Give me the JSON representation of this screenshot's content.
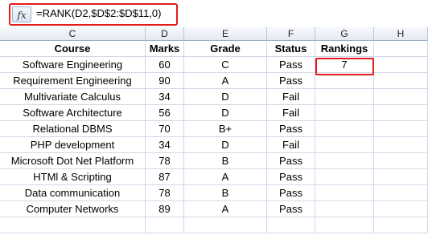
{
  "formula_bar": {
    "fx_icon": "fx-icon",
    "formula": "=RANK(D2,$D$2:$D$11,0)"
  },
  "columns": [
    "C",
    "D",
    "E",
    "F",
    "G",
    "H"
  ],
  "headers": {
    "course": "Course",
    "marks": "Marks",
    "grade": "Grade",
    "status": "Status",
    "rankings": "Rankings"
  },
  "rows": [
    {
      "course": "Software Engineering",
      "marks": "60",
      "grade": "C",
      "status": "Pass",
      "ranking": "7"
    },
    {
      "course": "Requirement Engineering",
      "marks": "90",
      "grade": "A",
      "status": "Pass",
      "ranking": ""
    },
    {
      "course": "Multivariate Calculus",
      "marks": "34",
      "grade": "D",
      "status": "Fail",
      "ranking": ""
    },
    {
      "course": "Software Architecture",
      "marks": "56",
      "grade": "D",
      "status": "Fail",
      "ranking": ""
    },
    {
      "course": "Relational DBMS",
      "marks": "70",
      "grade": "B+",
      "status": "Pass",
      "ranking": ""
    },
    {
      "course": "PHP development",
      "marks": "34",
      "grade": "D",
      "status": "Fail",
      "ranking": ""
    },
    {
      "course": "Microsoft Dot Net Platform",
      "marks": "78",
      "grade": "B",
      "status": "Pass",
      "ranking": ""
    },
    {
      "course": "HTMl & Scripting",
      "marks": "87",
      "grade": "A",
      "status": "Pass",
      "ranking": ""
    },
    {
      "course": "Data communication",
      "marks": "78",
      "grade": "B",
      "status": "Pass",
      "ranking": ""
    },
    {
      "course": "Computer Networks",
      "marks": "89",
      "grade": "A",
      "status": "Pass",
      "ranking": ""
    }
  ],
  "colors": {
    "highlight": "#e21b1b",
    "gridline": "#d0d7e5",
    "header_bg": "#e4eaf2"
  }
}
